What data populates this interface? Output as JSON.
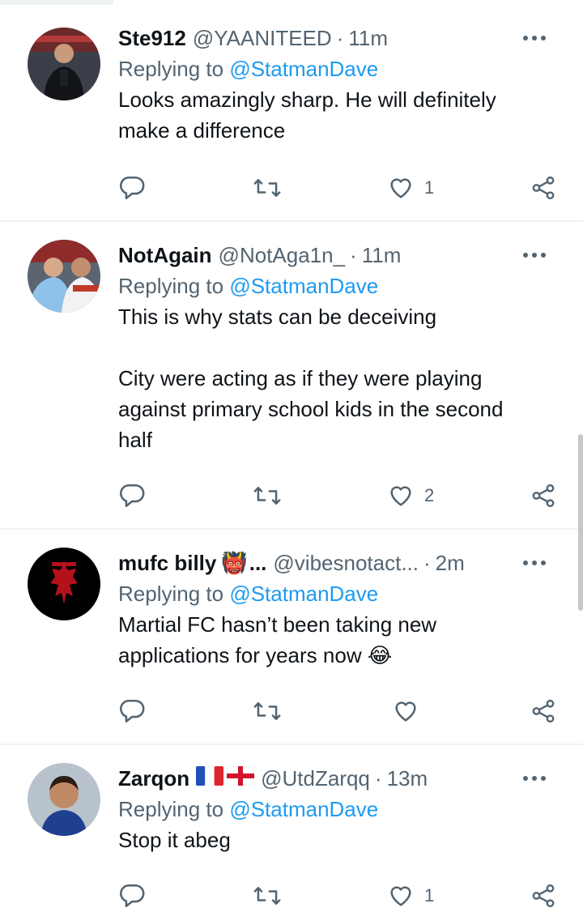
{
  "colors": {
    "link": "#1d9bf0",
    "muted": "#536471",
    "text": "#0f1419",
    "divider": "#eff3f4"
  },
  "tweets": [
    {
      "name": "Ste912",
      "handle": "@YAANITEED",
      "dot": "·",
      "time": "11m",
      "replying_prefix": "Replying to ",
      "replying_to": "@StatmanDave",
      "text": "Looks amazingly sharp. He will definitely\nmake a difference",
      "reply_count": "",
      "retweet_count": "",
      "like_count": "1"
    },
    {
      "name": "NotAgain",
      "handle": "@NotAga1n_",
      "dot": "·",
      "time": "11m",
      "replying_prefix": "Replying to ",
      "replying_to": "@StatmanDave",
      "text": "This is why stats can be deceiving\n\nCity were acting as if they were playing\nagainst primary school kids in the second\nhalf",
      "reply_count": "",
      "retweet_count": "",
      "like_count": "2"
    },
    {
      "name": "mufc billy",
      "name_emoji": "👹",
      "name_ellipsis": "...",
      "handle": "@vibesnotact...",
      "dot": "·",
      "time": "2m",
      "replying_prefix": "Replying to ",
      "replying_to": "@StatmanDave",
      "text": "Martial FC hasn’t been taking new\napplications for years now 😂",
      "reply_count": "",
      "retweet_count": "",
      "like_count": ""
    },
    {
      "name": "Zarqon",
      "flags": [
        "france-flag",
        "england-flag"
      ],
      "handle": "@UtdZarqq",
      "dot": "·",
      "time": "13m",
      "replying_prefix": "Replying to ",
      "replying_to": "@StatmanDave",
      "text": "Stop it abeg",
      "reply_count": "",
      "retweet_count": "",
      "like_count": "1"
    }
  ],
  "icons": {
    "reply": "reply-icon",
    "retweet": "retweet-icon",
    "like": "heart-icon",
    "share": "share-icon",
    "more": "more-options-icon"
  }
}
